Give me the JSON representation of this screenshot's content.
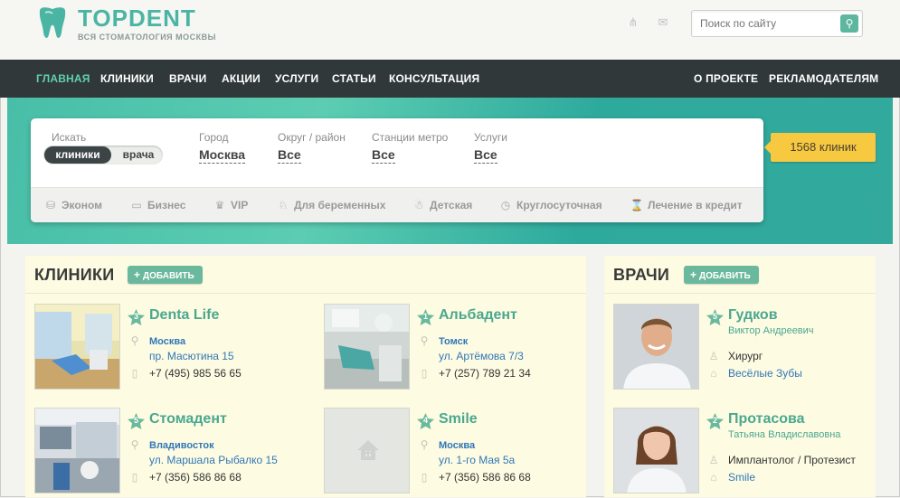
{
  "logo": {
    "title": "TOPDENT",
    "subtitle": "ВСЯ СТОМАТОЛОГИЯ МОСКВЫ"
  },
  "header_icons": [
    "sitemap-icon",
    "mail-icon"
  ],
  "search": {
    "placeholder": "Поиск по сайту",
    "button_icon": "search-icon"
  },
  "nav": {
    "items": [
      "ГЛАВНАЯ",
      "КЛИНИКИ",
      "ВРАЧИ",
      "АКЦИИ",
      "УСЛУГИ",
      "СТАТЬИ",
      "КОНСУЛЬТАЦИЯ"
    ],
    "right_items": [
      "О ПРОЕКТЕ",
      "РЕКЛАМОДАТЕЛЯМ"
    ],
    "active": "ГЛАВНАЯ"
  },
  "filters": {
    "search_label": "Искать",
    "toggle": {
      "selected": "клиники",
      "other": "врача"
    },
    "city": {
      "label": "Город",
      "value": "Москва"
    },
    "district": {
      "label": "Округ / район",
      "value": "Все"
    },
    "metro": {
      "label": "Станции метро",
      "value": "Все"
    },
    "services": {
      "label": "Услуги",
      "value": "Все"
    },
    "categories": [
      {
        "label": "Эконом",
        "icon": "coins-icon"
      },
      {
        "label": "Бизнес",
        "icon": "wallet-icon"
      },
      {
        "label": "VIP",
        "icon": "crown-icon"
      },
      {
        "label": "Для беременных",
        "icon": "stroller-icon"
      },
      {
        "label": "Детская",
        "icon": "child-icon"
      },
      {
        "label": "Круглосуточная",
        "icon": "clock-24-icon"
      },
      {
        "label": "Лечение в кредит",
        "icon": "credit-icon"
      }
    ]
  },
  "count_badge": "1568 клиник",
  "clinics": {
    "title": "КЛИНИКИ",
    "add_label": "ДОБАВИТЬ",
    "items": [
      {
        "rank": "3",
        "name": "Denta Life",
        "city": "Москва",
        "address": "пр. Масютина 15",
        "phone": "+7 (495) 985 56 65"
      },
      {
        "rank": "1",
        "name": "Альбадент",
        "city": "Томск",
        "address": "ул. Артёмова 7/3",
        "phone": "+7 (257) 789 21 34"
      },
      {
        "rank": "5",
        "name": "Стомадент",
        "city": "Владивосток",
        "address": "ул. Маршала Рыбалко 15",
        "phone": "+7 (356) 586 86 68"
      },
      {
        "rank": "4",
        "name": "Smile",
        "city": "Москва",
        "address": "ул. 1-го Мая 5а",
        "phone": "+7 (356) 586 86 68"
      }
    ]
  },
  "doctors": {
    "title": "ВРАЧИ",
    "add_label": "ДОБАВИТЬ",
    "items": [
      {
        "rank": "5",
        "surname": "Гудков",
        "name": "Виктор Андреевич",
        "specialty": "Хирург",
        "clinic": "Весёлые Зубы"
      },
      {
        "rank": "2",
        "surname": "Протасова",
        "name": "Татьяна Владиславовна",
        "specialty": "Имплантолог / Протезист",
        "clinic": "Smile"
      }
    ]
  },
  "colors": {
    "accent": "#4bb5a4",
    "nav_bg": "#31383a",
    "nav_active": "#5fd0b1",
    "badge": "#f7c940",
    "link": "#3177b7",
    "card_bg": "#fdfbe2"
  }
}
